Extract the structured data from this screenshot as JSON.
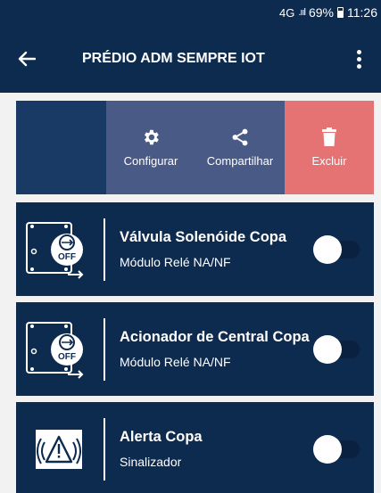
{
  "status_bar": {
    "network": "4G",
    "battery": "69%",
    "time": "11:26"
  },
  "app_bar": {
    "title": "PRÉDIO ADM SEMPRE IOT"
  },
  "actions": {
    "configure": "Configurar",
    "share": "Compartilhar",
    "delete": "Excluir"
  },
  "devices": [
    {
      "name": "Válvula Solenóide Copa",
      "type": "Módulo Relé NA/NF",
      "icon": "relay-module-icon",
      "on": false
    },
    {
      "name": "Acionador de Central Copa",
      "type": "Módulo Relé NA/NF",
      "icon": "relay-module-icon",
      "on": false
    },
    {
      "name": "Alerta Copa",
      "type": "Sinalizador",
      "icon": "alarm-signal-icon",
      "on": false
    }
  ],
  "colors": {
    "primary": "#0d2a4f",
    "action_bg": "#4a5a86",
    "delete_bg": "#e57373",
    "background": "#f2f2f2"
  }
}
